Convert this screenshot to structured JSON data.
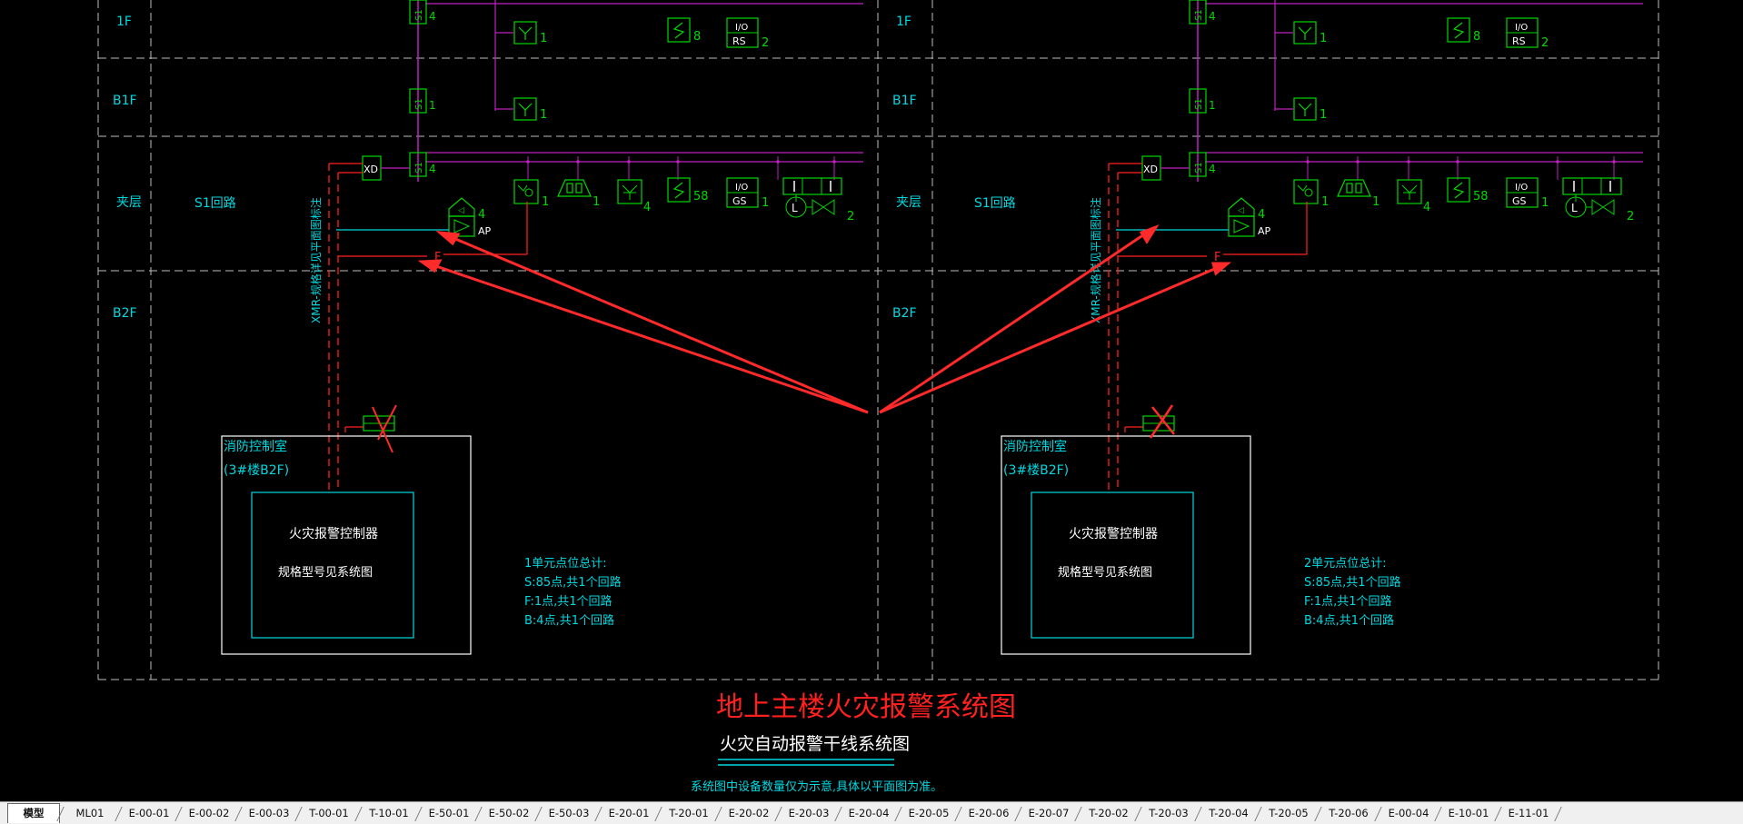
{
  "colors": {
    "background": "#000000",
    "grid": "#bdbdbd",
    "device": "#00d800",
    "bus": "#c020c0",
    "cyan": "#00d8e0",
    "red": "#ff2020",
    "white": "#ffffff",
    "annotation": "#ff2a2a"
  },
  "floors": {
    "f1": "1F",
    "b1f": "B1F",
    "mezz": "夹层",
    "b2f": "B2F"
  },
  "loop_label": "S1回路",
  "cable_note": "XMR-规格详见平面图标注",
  "modules": {
    "xd": "XD",
    "s1": "S1",
    "ap": "AP",
    "io": "I/O",
    "rs": "RS",
    "gs": "GS",
    "f": "F",
    "l": "L"
  },
  "panels": [
    {
      "row1": {
        "s1": "4",
        "y": "1",
        "s": "8",
        "rs": "2"
      },
      "rowb1": {
        "s1": "1",
        "y": "1"
      },
      "rowm": {
        "s1": "4",
        "yo": "1",
        "bell": "1",
        "yb": "4",
        "s": "58",
        "gs": "1",
        "valve": "2",
        "ap": "4"
      },
      "room_title": "消防控制室",
      "room_sub": "(3#楼B2F)",
      "controller": "火灾报警控制器",
      "controller_sub": "规格型号见系统图",
      "stats": [
        "1单元点位总计:",
        "S:85点,共1个回路",
        "F:1点,共1个回路",
        "B:4点,共1个回路"
      ]
    },
    {
      "row1": {
        "s1": "4",
        "y": "1",
        "s": "8",
        "rs": "2"
      },
      "rowb1": {
        "s1": "1",
        "y": "1"
      },
      "rowm": {
        "s1": "4",
        "yo": "1",
        "bell": "1",
        "yb": "4",
        "s": "58",
        "gs": "1",
        "valve": "2",
        "ap": "4"
      },
      "room_title": "消防控制室",
      "room_sub": "(3#楼B2F)",
      "controller": "火灾报警控制器",
      "controller_sub": "规格型号见系统图",
      "stats": [
        "2单元点位总计:",
        "S:85点,共1个回路",
        "F:1点,共1个回路",
        "B:4点,共1个回路"
      ]
    }
  ],
  "main_title": "地上主楼火灾报警系统图",
  "sub_title": "火灾自动报警干线系统图",
  "note": "系统图中设备数量仅为示意,具体以平面图为准。",
  "tabs": [
    "模型",
    "ML01",
    "E-00-01",
    "E-00-02",
    "E-00-03",
    "T-00-01",
    "T-10-01",
    "E-50-01",
    "E-50-02",
    "E-50-03",
    "E-20-01",
    "T-20-01",
    "E-20-02",
    "E-20-03",
    "E-20-04",
    "E-20-05",
    "E-20-06",
    "E-20-07",
    "T-20-02",
    "T-20-03",
    "T-20-04",
    "T-20-05",
    "T-20-06",
    "E-00-04",
    "E-10-01",
    "E-11-01"
  ],
  "active_tab": "模型"
}
